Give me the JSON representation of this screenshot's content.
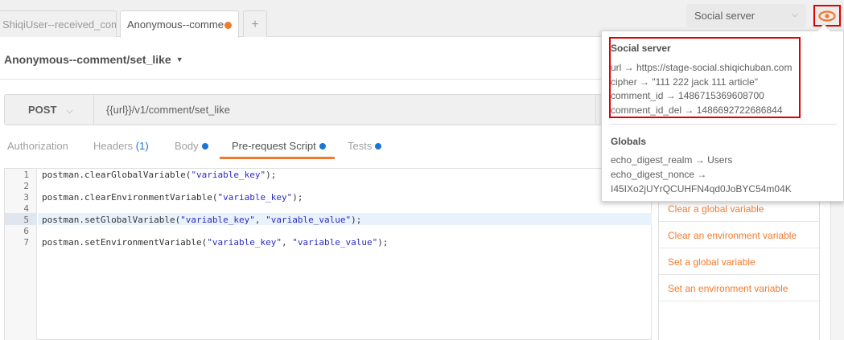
{
  "tabs": {
    "items": [
      {
        "label": "ShiqiUser--received_com",
        "active": false
      },
      {
        "label": "Anonymous--comme",
        "active": true,
        "unsaved": true
      }
    ],
    "add_label": "+"
  },
  "environment": {
    "selected": "Social server",
    "eye_icon": "eye-icon",
    "accent": "#f07a2e"
  },
  "request": {
    "name": "Anonymous--comment/set_like",
    "method": "POST",
    "url": "{{url}}/v1/comment/set_like"
  },
  "subtabs": [
    {
      "label": "Authorization"
    },
    {
      "label": "Headers",
      "count": "(1)"
    },
    {
      "label": "Body",
      "dot": true
    },
    {
      "label": "Pre-request Script",
      "dot": true,
      "active": true
    },
    {
      "label": "Tests",
      "dot": true
    }
  ],
  "editor": {
    "lines": [
      {
        "num": "1",
        "pre": "postman.clearGlobalVariable(",
        "s1": "\"variable_key\"",
        "mid": "",
        "s2": "",
        "post": ");"
      },
      {
        "num": "2",
        "pre": "",
        "s1": "",
        "mid": "",
        "s2": "",
        "post": ""
      },
      {
        "num": "3",
        "pre": "postman.clearEnvironmentVariable(",
        "s1": "\"variable_key\"",
        "mid": "",
        "s2": "",
        "post": ");"
      },
      {
        "num": "4",
        "pre": "",
        "s1": "",
        "mid": "",
        "s2": "",
        "post": ""
      },
      {
        "num": "5",
        "pre": "postman.setGlobalVariable(",
        "s1": "\"variable_key\"",
        "mid": ", ",
        "s2": "\"variable_value\"",
        "post": ");"
      },
      {
        "num": "6",
        "pre": "",
        "s1": "",
        "mid": "",
        "s2": "",
        "post": ""
      },
      {
        "num": "7",
        "pre": "postman.setEnvironmentVariable(",
        "s1": "\"variable_key\"",
        "mid": ", ",
        "s2": "\"variable_value\"",
        "post": ");"
      }
    ]
  },
  "snippets": [
    "Clear a global variable",
    "Clear an environment variable",
    "Set a global variable",
    "Set an environment variable"
  ],
  "quicklook": {
    "env_title": "Social server",
    "env_vars": [
      "url → https://stage-social.shiqichuban.com",
      "cipher → \"111 222 jack 111 article\"",
      "comment_id → 1486715369608700",
      "comment_id_del → 1486692722686844"
    ],
    "globals_title": "Globals",
    "global_vars": [
      "echo_digest_realm → Users",
      "echo_digest_nonce →",
      "I45IXo2jUYrQCUHFN4qd0JoBYC54m04K"
    ]
  }
}
